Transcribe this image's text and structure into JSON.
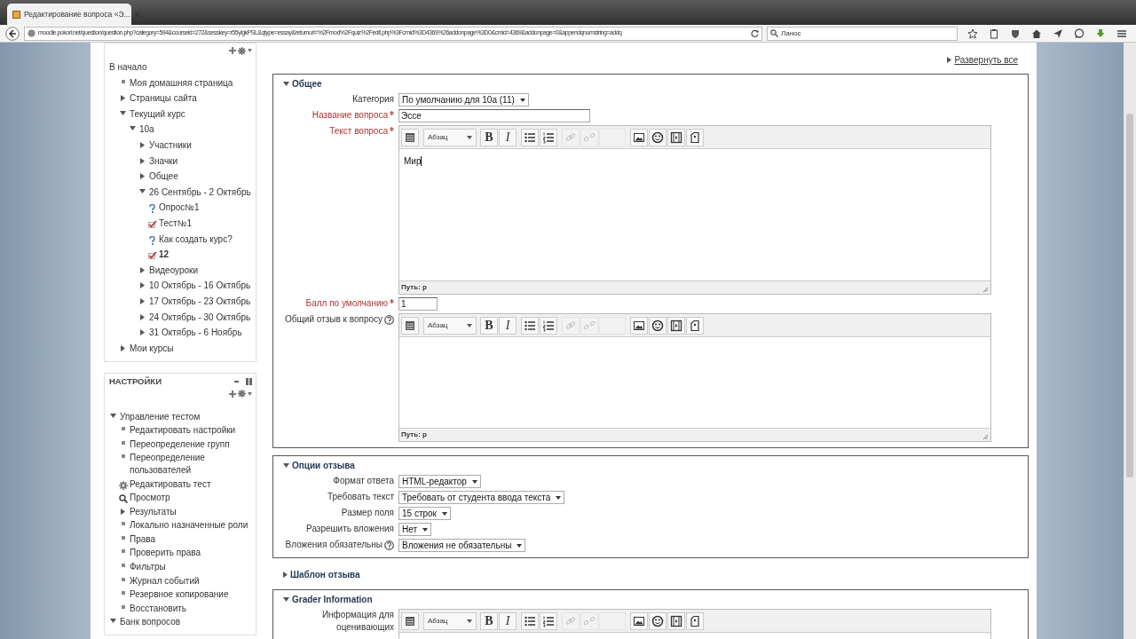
{
  "browser": {
    "tab_title": "Редактирование вопроса «Э...",
    "url": "moodle.pokori.net/question/question.php?category=594&courseid=272&sesskey=r55ylgkPSL&qtype=essay&returnurl=%2Fmod%2Fquiz%2Fedit.php%3Fcmid%3D4369%26addonpage%3D0&cmid=4369&addonpage=0&appendqnumstring=addq",
    "search_value": "Ланос"
  },
  "navigation": {
    "items": [
      {
        "label": "В начало",
        "kind": "plain",
        "children": [
          {
            "label": "Моя домашняя страница",
            "kind": "bullet"
          },
          {
            "label": "Страницы сайта",
            "kind": "branch",
            "expanded": false
          },
          {
            "label": "Текущий курс",
            "kind": "branch",
            "expanded": true,
            "children": [
              {
                "label": "10а",
                "kind": "branch",
                "expanded": true,
                "children": [
                  {
                    "label": "Участники",
                    "kind": "branch",
                    "expanded": false
                  },
                  {
                    "label": "Значки",
                    "kind": "branch",
                    "expanded": false
                  },
                  {
                    "label": "Общее",
                    "kind": "branch",
                    "expanded": false
                  },
                  {
                    "label": "26 Сентябрь - 2 Октябрь",
                    "kind": "branch",
                    "expanded": true,
                    "children": [
                      {
                        "label": "Опрос№1",
                        "kind": "question",
                        "current": false
                      },
                      {
                        "label": "Тест№1",
                        "kind": "quiz",
                        "current": false
                      },
                      {
                        "label": "Как создать курс?",
                        "kind": "question",
                        "current": false
                      },
                      {
                        "label": "12",
                        "kind": "quiz",
                        "current": true
                      }
                    ]
                  },
                  {
                    "label": "Видеоуроки",
                    "kind": "branch",
                    "expanded": false
                  },
                  {
                    "label": "10 Октябрь - 16 Октябрь",
                    "kind": "branch",
                    "expanded": false
                  },
                  {
                    "label": "17 Октябрь - 23 Октябрь",
                    "kind": "branch",
                    "expanded": false
                  },
                  {
                    "label": "24 Октябрь - 30 Октябрь",
                    "kind": "branch",
                    "expanded": false
                  },
                  {
                    "label": "31 Октябрь - 6 Ноябрь",
                    "kind": "branch",
                    "expanded": false
                  }
                ]
              }
            ]
          },
          {
            "label": "Мои курсы",
            "kind": "branch",
            "expanded": false
          }
        ]
      }
    ]
  },
  "settings": {
    "title": "НАСТРОЙКИ",
    "items": [
      {
        "label": "Управление тестом",
        "kind": "branch",
        "expanded": true,
        "children": [
          {
            "label": "Редактировать настройки",
            "kind": "bullet"
          },
          {
            "label": "Переопределение групп",
            "kind": "bullet"
          },
          {
            "label": "Переопределение пользователей",
            "kind": "bullet"
          },
          {
            "label": "Редактировать тест",
            "kind": "gear"
          },
          {
            "label": "Просмотр",
            "kind": "search"
          },
          {
            "label": "Результаты",
            "kind": "branch",
            "expanded": false
          },
          {
            "label": "Локально назначенные роли",
            "kind": "bullet"
          },
          {
            "label": "Права",
            "kind": "bullet"
          },
          {
            "label": "Проверить права",
            "kind": "bullet"
          },
          {
            "label": "Фильтры",
            "kind": "bullet"
          },
          {
            "label": "Журнал событий",
            "kind": "bullet"
          },
          {
            "label": "Резервное копирование",
            "kind": "bullet"
          },
          {
            "label": "Восстановить",
            "kind": "bullet"
          }
        ]
      },
      {
        "label": "Банк вопросов",
        "kind": "branch",
        "expanded": true
      }
    ]
  },
  "form": {
    "expand_all": "Развернуть все",
    "sections": [
      {
        "title": "Общее",
        "expanded": true,
        "fields": [
          {
            "label": "Категория",
            "kind": "select",
            "value": "По умолчанию для 10а (11)",
            "required": false,
            "help": false
          },
          {
            "label": "Название вопроса",
            "kind": "text",
            "value": "Эссе",
            "required": true,
            "help": false
          },
          {
            "label": "Текст вопроса",
            "kind": "editor",
            "value": "Мир",
            "path": "Путь: p",
            "required": true,
            "help": false,
            "toolbar": [
              {
                "kind": "toggle",
                "disabled": false
              },
              {
                "kind": "format",
                "label": "Абзац",
                "disabled": false
              },
              {
                "kind": "bold",
                "label": "B",
                "disabled": false
              },
              {
                "kind": "italic",
                "label": "I",
                "disabled": false
              },
              {
                "kind": "ul",
                "disabled": false
              },
              {
                "kind": "ol",
                "disabled": false
              },
              {
                "kind": "link",
                "disabled": true
              },
              {
                "kind": "unlink",
                "disabled": true
              },
              {
                "kind": "blank",
                "disabled": true
              },
              {
                "kind": "image",
                "disabled": false
              },
              {
                "kind": "emoticon",
                "disabled": false
              },
              {
                "kind": "media",
                "disabled": false
              },
              {
                "kind": "manage",
                "disabled": false
              }
            ]
          },
          {
            "label": "Балл по умолчанию",
            "kind": "text",
            "value": "1",
            "required": true,
            "help": false
          },
          {
            "label": "Общий отзыв к вопросу",
            "kind": "editor",
            "path": "Путь: p",
            "required": false,
            "help": true,
            "toolbar": [
              {
                "kind": "toggle",
                "disabled": false
              },
              {
                "kind": "format",
                "label": "Абзац",
                "disabled": false
              },
              {
                "kind": "bold",
                "label": "B",
                "disabled": false
              },
              {
                "kind": "italic",
                "label": "I",
                "disabled": false
              },
              {
                "kind": "ul",
                "disabled": false
              },
              {
                "kind": "ol",
                "disabled": false
              },
              {
                "kind": "link",
                "disabled": true
              },
              {
                "kind": "unlink",
                "disabled": true
              },
              {
                "kind": "blank",
                "disabled": true
              },
              {
                "kind": "image",
                "disabled": false
              },
              {
                "kind": "emoticon",
                "disabled": false
              },
              {
                "kind": "media",
                "disabled": false
              },
              {
                "kind": "manage",
                "disabled": false
              }
            ]
          }
        ]
      },
      {
        "title": "Опции отзыва",
        "expanded": true,
        "fields": [
          {
            "label": "Формат ответа",
            "kind": "select",
            "value": "HTML-редактор",
            "required": false,
            "help": false
          },
          {
            "label": "Требовать текст",
            "kind": "select",
            "value": "Требовать от студента ввода текста",
            "required": false,
            "help": false
          },
          {
            "label": "Размер поля",
            "kind": "select",
            "value": "15 строк",
            "required": false,
            "help": false
          },
          {
            "label": "Разрешить вложения",
            "kind": "select",
            "value": "Нет",
            "required": false,
            "help": false
          },
          {
            "label": "Вложения обязательны",
            "kind": "select",
            "value": "Вложения не обязательны",
            "required": false,
            "help": true
          }
        ]
      },
      {
        "title": "Шаблон отзыва",
        "expanded": false
      },
      {
        "title": "Grader Information",
        "expanded": true,
        "fields": [
          {
            "label": "Информация для оценивающих",
            "kind": "editor",
            "required": false,
            "help": false,
            "toolbar": [
              {
                "kind": "toggle",
                "disabled": false
              },
              {
                "kind": "format",
                "label": "Абзац",
                "disabled": false
              },
              {
                "kind": "bold",
                "label": "B",
                "disabled": false
              },
              {
                "kind": "italic",
                "label": "I",
                "disabled": false
              },
              {
                "kind": "ul",
                "disabled": false
              },
              {
                "kind": "ol",
                "disabled": false
              },
              {
                "kind": "link",
                "disabled": true
              },
              {
                "kind": "unlink",
                "disabled": true
              },
              {
                "kind": "blank",
                "disabled": true
              },
              {
                "kind": "image",
                "disabled": false
              },
              {
                "kind": "emoticon",
                "disabled": false
              },
              {
                "kind": "media",
                "disabled": false
              },
              {
                "kind": "manage",
                "disabled": false
              }
            ]
          }
        ]
      }
    ]
  }
}
